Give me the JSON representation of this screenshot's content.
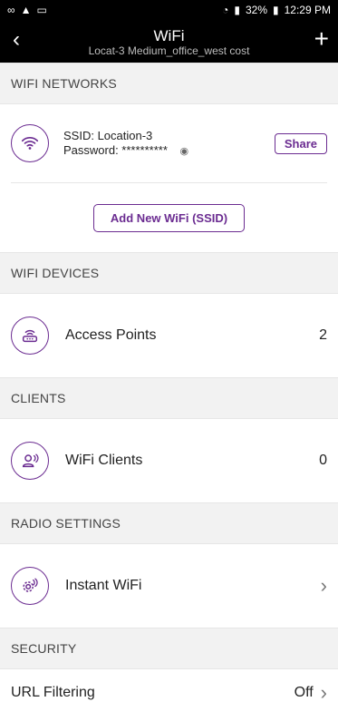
{
  "status_bar": {
    "battery": "32%",
    "time": "12:29 PM"
  },
  "header": {
    "title": "WiFi",
    "subtitle": "Locat-3 Medium_office_west cost"
  },
  "sections": {
    "wifi_networks": "WIFI NETWORKS",
    "wifi_devices": "WIFI DEVICES",
    "clients": "CLIENTS",
    "radio_settings": "RADIO SETTINGS",
    "security": "SECURITY"
  },
  "network": {
    "ssid": "SSID: Location-3",
    "password": "Password: **********",
    "share_label": "Share",
    "add_label": "Add New WiFi (SSID)"
  },
  "access_points": {
    "label": "Access Points",
    "value": "2"
  },
  "wifi_clients": {
    "label": "WiFi Clients",
    "value": "0"
  },
  "instant_wifi": {
    "label": "Instant WiFi"
  },
  "url_filtering": {
    "label": "URL Filtering",
    "value": "Off"
  },
  "icons": {
    "wifi": "wifi-icon",
    "router": "router-icon",
    "user": "user-wifi-icon",
    "gear": "gear-wifi-icon",
    "eye": "eye-icon",
    "back": "back-icon",
    "plus": "plus-icon"
  },
  "colors": {
    "accent": "#6b2c91",
    "header_bg": "#000000",
    "section_bg": "#f2f2f2"
  }
}
